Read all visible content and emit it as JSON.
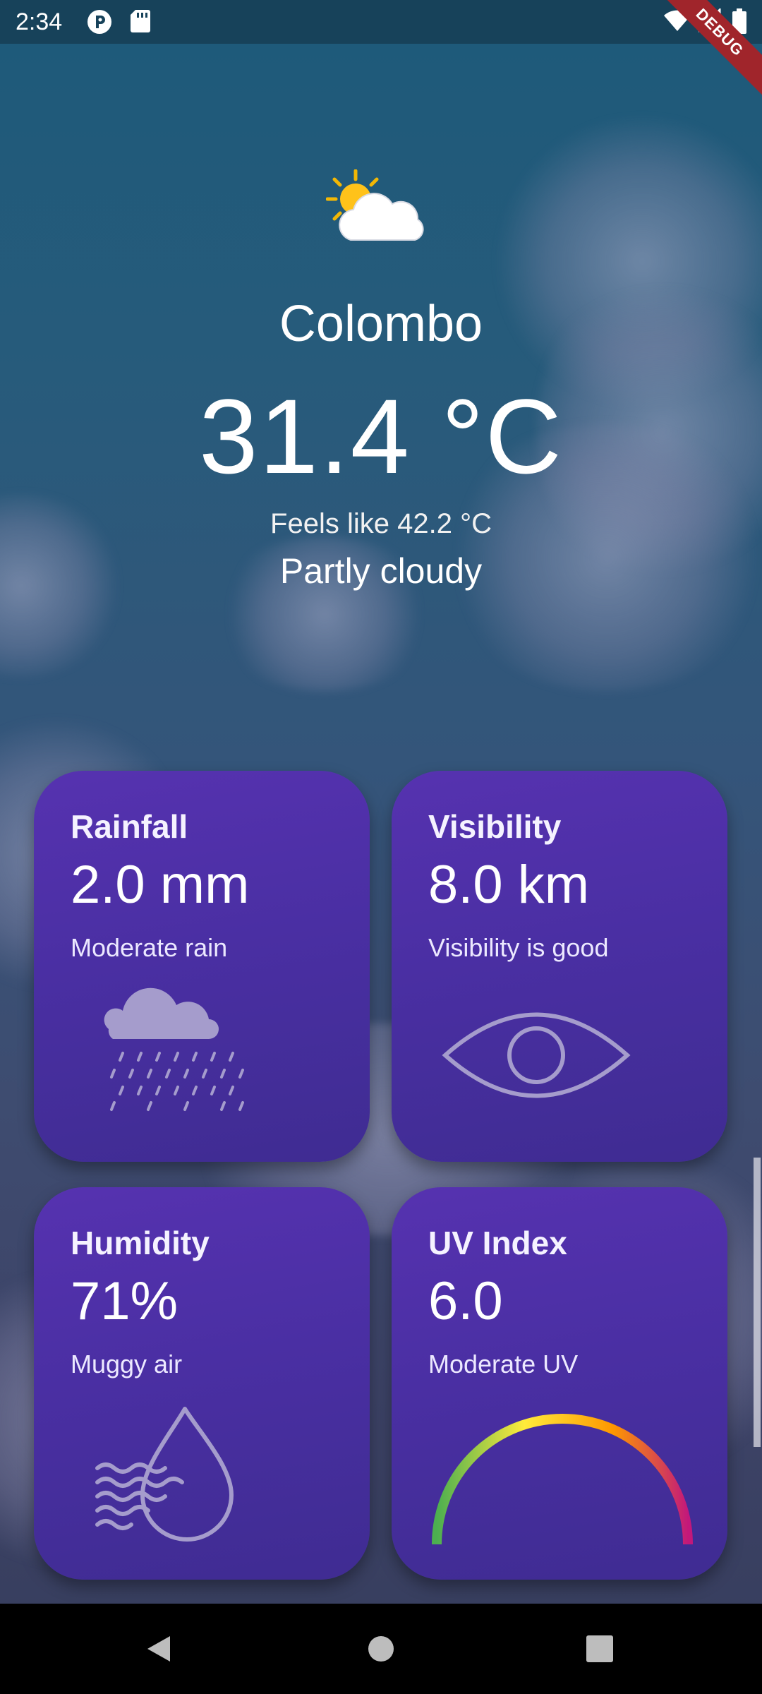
{
  "status_bar": {
    "time": "2:34",
    "debug_label": "DEBUG",
    "icons": [
      "p-icon",
      "sd-card-icon",
      "wifi-icon",
      "signal-icon",
      "battery-icon"
    ]
  },
  "weather": {
    "city": "Colombo",
    "temperature": "31.4 °C",
    "feels_like": "Feels like 42.2 °C",
    "condition": "Partly cloudy",
    "icon": "partly-cloudy-icon"
  },
  "cards": {
    "rainfall": {
      "title": "Rainfall",
      "value": "2.0 mm",
      "desc": "Moderate rain",
      "icon": "rain-cloud-icon"
    },
    "visibility": {
      "title": "Visibility",
      "value": "8.0 km",
      "desc": "Visibility is good",
      "icon": "eye-icon"
    },
    "humidity": {
      "title": "Humidity",
      "value": "71%",
      "desc": "Muggy air",
      "icon": "humidity-drop-icon"
    },
    "uv": {
      "title": "UV Index",
      "value": "6.0",
      "desc": "Moderate UV",
      "icon": "uv-gauge-icon"
    }
  },
  "colors": {
    "card_top": "#5632b0",
    "card_bottom": "#3f2c92",
    "sky": "#1d5a7a",
    "debug_banner": "#a0252b"
  },
  "nav": {
    "back": "back-icon",
    "home": "home-icon",
    "recents": "recents-icon"
  }
}
